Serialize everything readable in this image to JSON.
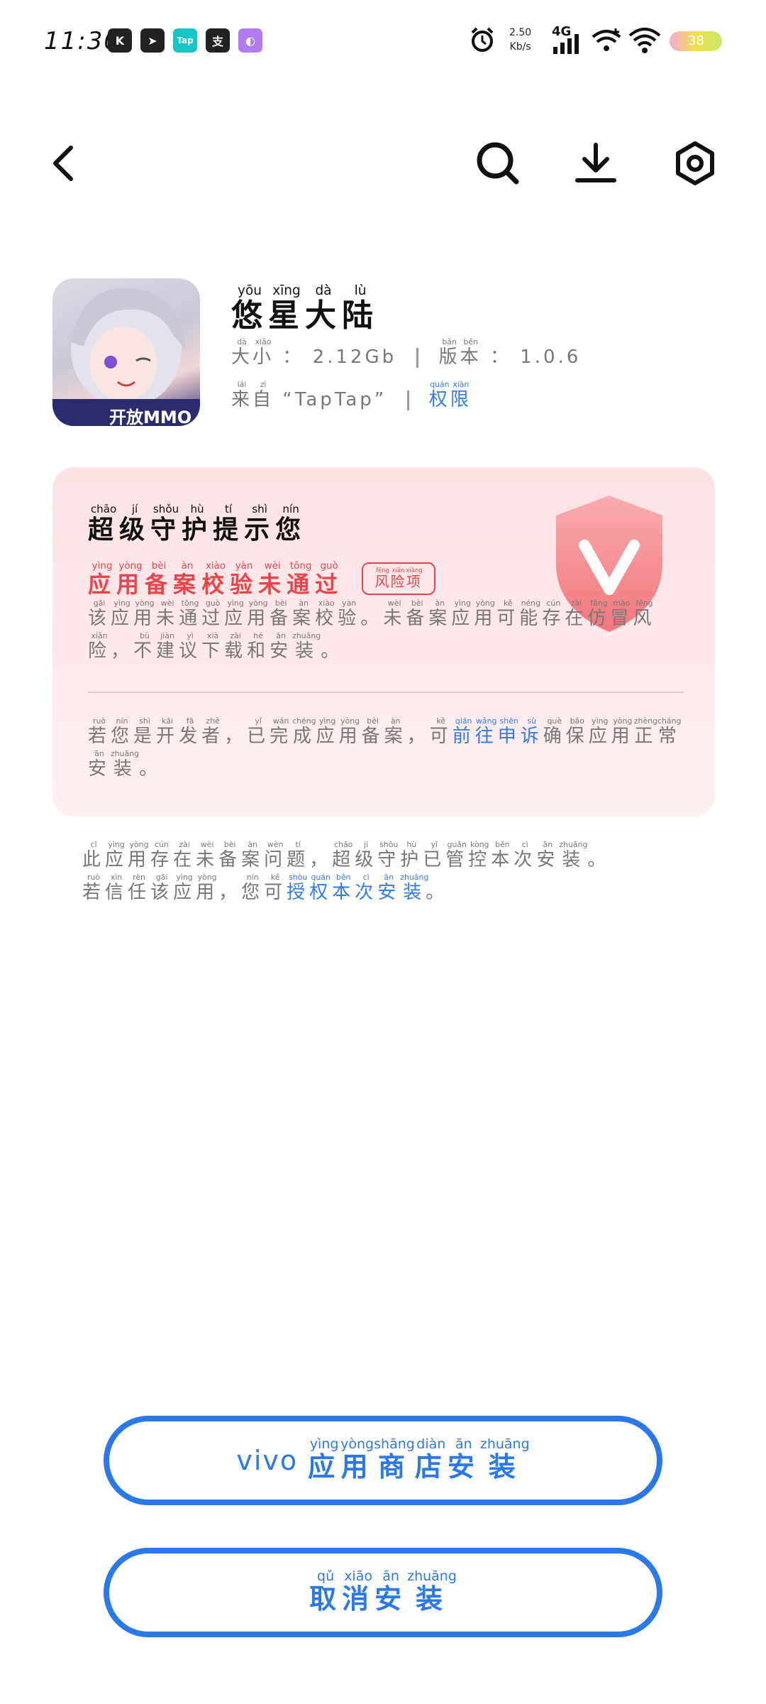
{
  "status_bar": {
    "time": "11:30",
    "net_speed_value": "2.50",
    "net_speed_unit": "Kb/s",
    "network": "4G",
    "battery": "38",
    "app_icons": [
      {
        "name": "k-app-icon",
        "glyph": "K",
        "color": "#222222"
      },
      {
        "name": "telegram-icon",
        "glyph": "➤",
        "color": "#222222"
      },
      {
        "name": "taptap-icon",
        "glyph": "Tap",
        "color": "#16c6c6"
      },
      {
        "name": "alipay-icon",
        "glyph": "支",
        "color": "#222222"
      },
      {
        "name": "purple-app-icon",
        "glyph": "◐",
        "color": "#b07cf0"
      }
    ]
  },
  "nav": {
    "back_icon": "chevron-left-icon",
    "search_icon": "search-icon",
    "download_icon": "download-icon",
    "settings_icon": "settings-icon"
  },
  "app": {
    "name": "悠星大陆",
    "name_pinyin": [
      "yōu",
      "xīng",
      "dà",
      "lù"
    ],
    "name_chars": [
      "悠",
      "星",
      "大",
      "陆"
    ],
    "size_label": "大小",
    "size_label_pinyin": [
      "dà",
      "xiǎo"
    ],
    "size_label_chars": [
      "大",
      "小"
    ],
    "size_value": "2.12Gb",
    "version_label": "版本",
    "version_label_pinyin": [
      "bǎn",
      "běn"
    ],
    "version_label_chars": [
      "版",
      "本"
    ],
    "version_value": "1.0.6",
    "source_label": "来自",
    "source_label_pinyin": [
      "lái",
      "zì"
    ],
    "source_label_chars": [
      "来",
      "自"
    ],
    "source_value": "“TapTap”",
    "permissions_link": "权限",
    "permissions_pinyin": [
      "quán",
      "xiàn"
    ],
    "permissions_chars": [
      "权",
      "限"
    ],
    "thumbnail_text": "开放MMO"
  },
  "warning": {
    "title_chars": [
      "超",
      "级",
      "守",
      "护",
      "提",
      "示",
      "您"
    ],
    "title_pinyin": [
      "chāo",
      "jí",
      "shǒu",
      "hù",
      "tí",
      "shì",
      "nín"
    ],
    "risk_heading_chars": [
      "应",
      "用",
      "备",
      "案",
      "校",
      "验",
      "未",
      "通",
      "过"
    ],
    "risk_heading_pinyin": [
      "yìng",
      "yòng",
      "bèi",
      "àn",
      "xiào",
      "yàn",
      "wèi",
      "tōng",
      "guò"
    ],
    "risk_badge_chars": [
      "风",
      "险",
      "项"
    ],
    "risk_badge_pinyin": [
      "fēng",
      "xiǎn",
      "xiàng"
    ],
    "para1_chars": [
      "该",
      "应",
      "用",
      "未",
      "通",
      "过",
      "应",
      "用",
      "备",
      "案",
      "校",
      "验",
      "。",
      "未",
      "备",
      "案",
      "应",
      "用",
      "可",
      "能",
      "存",
      "在",
      "仿",
      "冒",
      "风",
      "险",
      "，",
      "不",
      "建",
      "议",
      "下",
      "载",
      "和",
      "安",
      "装",
      "。"
    ],
    "para1_pinyin": [
      "gāi",
      "yìng",
      "yòng",
      "wèi",
      "tōng",
      "guò",
      "yìng",
      "yòng",
      "bèi",
      "àn",
      "xiào",
      "yàn",
      "",
      "wèi",
      "bèi",
      "àn",
      "yìng",
      "yòng",
      "kě",
      "néng",
      "cún",
      "zài",
      "fǎng",
      "mào",
      "fēng",
      "xiǎn",
      "",
      "bù",
      "jiàn",
      "yì",
      "xià",
      "zài",
      "hé",
      "ān",
      "zhuāng",
      ""
    ],
    "para2_chars": [
      "若",
      "您",
      "是",
      "开",
      "发",
      "者",
      "，",
      "已",
      "完",
      "成",
      "应",
      "用",
      "备",
      "案",
      "，",
      "可"
    ],
    "para2_pinyin": [
      "ruò",
      "nín",
      "shì",
      "kāi",
      "fā",
      "zhě",
      "",
      "yǐ",
      "wán",
      "chéng",
      "yìng",
      "yòng",
      "bèi",
      "àn",
      "",
      "kě"
    ],
    "para2_link_chars": [
      "前",
      "往",
      "申",
      "诉"
    ],
    "para2_link_pinyin": [
      "qián",
      "wǎng",
      "shēn",
      "sù"
    ],
    "para2_tail_chars": [
      "确",
      "保",
      "应",
      "用",
      "正",
      "常",
      "安",
      "装",
      "。"
    ],
    "para2_tail_pinyin": [
      "què",
      "bǎo",
      "yìng",
      "yòng",
      "zhèng",
      "cháng",
      "ān",
      "zhuāng",
      ""
    ]
  },
  "footnote": {
    "line1_chars": [
      "此",
      "应",
      "用",
      "存",
      "在",
      "未",
      "备",
      "案",
      "问",
      "题",
      "，",
      "超",
      "级",
      "守",
      "护",
      "已",
      "管",
      "控",
      "本",
      "次",
      "安",
      "装",
      "。"
    ],
    "line1_pinyin": [
      "cǐ",
      "yìng",
      "yòng",
      "cún",
      "zài",
      "wèi",
      "bèi",
      "àn",
      "wèn",
      "tí",
      "",
      "chāo",
      "jí",
      "shǒu",
      "hù",
      "yǐ",
      "guǎn",
      "kòng",
      "běn",
      "cì",
      "ān",
      "zhuāng",
      ""
    ],
    "line2_chars": [
      "若",
      "信",
      "任",
      "该",
      "应",
      "用",
      "，",
      "您",
      "可"
    ],
    "line2_pinyin": [
      "ruò",
      "xìn",
      "rèn",
      "gāi",
      "yìng",
      "yòng",
      "",
      "nín",
      "kě"
    ],
    "link_chars": [
      "授",
      "权",
      "本",
      "次",
      "安",
      "装"
    ],
    "link_pinyin": [
      "shòu",
      "quán",
      "běn",
      "cì",
      "ān",
      "zhuāng"
    ],
    "tail": "。"
  },
  "buttons": {
    "install_prefix": "vivo",
    "install_chars": [
      "应",
      "用",
      "商",
      "店",
      "安",
      "装"
    ],
    "install_pinyin": [
      "yìng",
      "yòng",
      "shāng",
      "diàn",
      "ān",
      "zhuāng"
    ],
    "cancel_chars": [
      "取",
      "消",
      "安",
      "装"
    ],
    "cancel_pinyin": [
      "qǔ",
      "xiāo",
      "ān",
      "zhuāng"
    ]
  },
  "colors": {
    "accent_blue": "#2a78ea",
    "risk_red": "#e8454a",
    "card_bg": "#fde2e4"
  }
}
